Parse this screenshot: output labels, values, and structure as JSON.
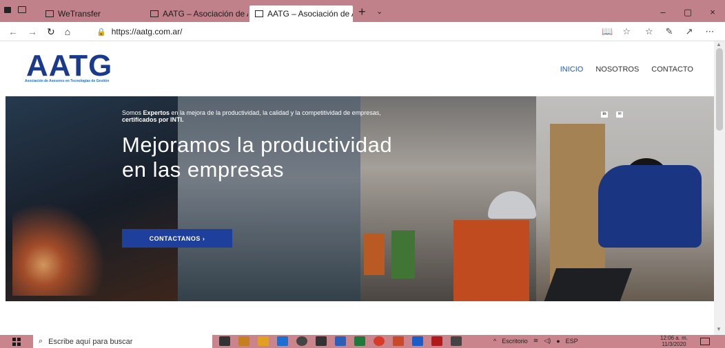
{
  "browser": {
    "tabs": [
      {
        "label": "WeTransfer",
        "active": false
      },
      {
        "label": "AATG – Asociación de Asesc",
        "active": false
      },
      {
        "label": "AATG – Asociación de A",
        "active": true
      }
    ],
    "new_tab": "+",
    "tab_list": "⌄",
    "close_tab": "×",
    "url": "https://aatg.com.ar/",
    "window_controls": {
      "minimize": "–",
      "maximize": "▢",
      "close": "×"
    }
  },
  "site": {
    "logo_text": "AATG",
    "logo_subtitle": "Asociación de Asesores en Tecnologías de Gestión",
    "menu": [
      {
        "label": "INICIO",
        "active": true
      },
      {
        "label": "NOSOTROS",
        "active": false
      },
      {
        "label": "CONTACTO",
        "active": false
      }
    ],
    "hero": {
      "tagline_prefix": "Somos ",
      "tagline_bold": "Expertos",
      "tagline_rest": " en la mejora de la productividad, la calidad y la competitividad de empresas,",
      "tagline_bold2": "certificados por INTI.",
      "headline": "Mejoramos la productividad en las empresas",
      "cta": "CONTACTANOS ›",
      "social": [
        "linkedin-icon",
        "mail-icon"
      ]
    }
  },
  "taskbar": {
    "search_placeholder": "Escribe aquí para buscar",
    "desktop_label": "Escritorio",
    "language": "ESP",
    "time": "12:06 a. m.",
    "date": "11/3/2020"
  },
  "colors": {
    "brand": "#1a3a8e",
    "cta": "#1e3f9c",
    "tabbar": "#c0818a"
  }
}
